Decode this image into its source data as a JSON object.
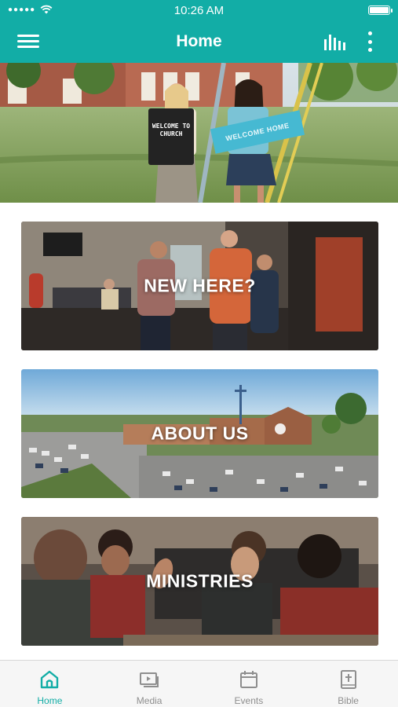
{
  "status_bar": {
    "signal": "●●●●●",
    "time": "10:26 AM",
    "wifi_icon": "wifi-icon",
    "battery_icon": "battery-icon"
  },
  "nav": {
    "title": "Home",
    "menu_icon": "hamburger-menu-icon",
    "chart_icon": "equalizer-icon",
    "more_icon": "more-vertical-icon",
    "color": "#12ada6"
  },
  "hero": {
    "sign_left": [
      "WELCOME TO",
      "CHURCH"
    ],
    "sign_right": "WELCOME HOME"
  },
  "cards": [
    {
      "label": "NEW HERE?"
    },
    {
      "label": "ABOUT US"
    },
    {
      "label": "MINISTRIES"
    }
  ],
  "tabs": [
    {
      "label": "Home",
      "icon": "home-icon",
      "active": true
    },
    {
      "label": "Media",
      "icon": "media-icon",
      "active": false
    },
    {
      "label": "Events",
      "icon": "calendar-icon",
      "active": false
    },
    {
      "label": "Bible",
      "icon": "bible-icon",
      "active": false
    }
  ]
}
